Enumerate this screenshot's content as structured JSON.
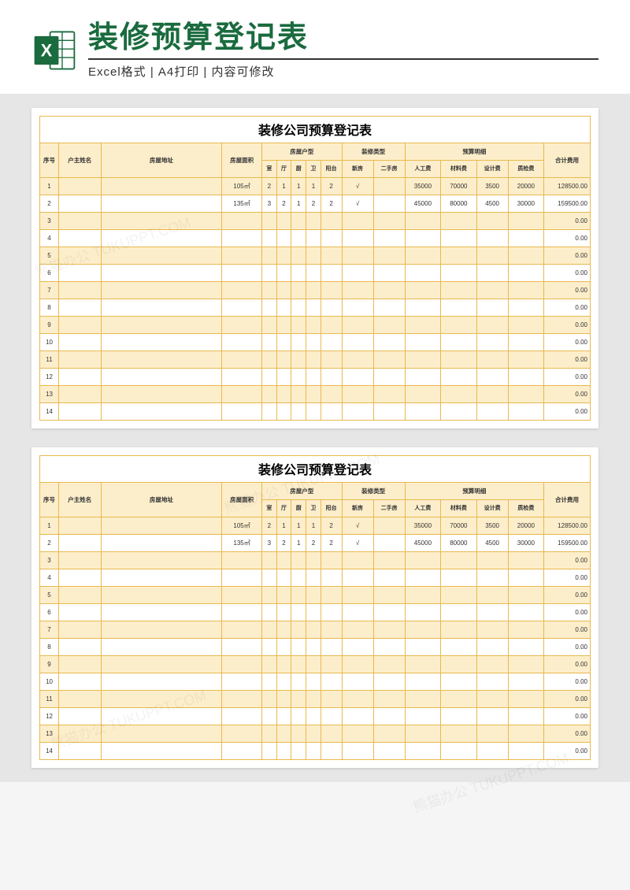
{
  "header": {
    "title": "装修预算登记表",
    "subtitle": "Excel格式 | A4打印 | 内容可修改",
    "icon_name": "excel-icon"
  },
  "sheet": {
    "title": "装修公司预算登记表",
    "columns": {
      "seq": "序号",
      "owner_name": "户主姓名",
      "address": "房屋地址",
      "area": "房屋面积",
      "house_type_group": "房屋户型",
      "room": "室",
      "hall": "厅",
      "kitchen": "厨",
      "bath": "卫",
      "balcony": "阳台",
      "decoration_type_group": "装修类型",
      "new_house": "新房",
      "second_hand": "二手房",
      "budget_detail_group": "预算明细",
      "labor_cost": "人工费",
      "material_cost": "材料费",
      "design_cost": "设计费",
      "quality_cost": "质检费",
      "total_cost": "合计费用"
    },
    "rows": [
      {
        "seq": "1",
        "owner_name": "",
        "address": "",
        "area": "105㎡",
        "room": "2",
        "hall": "1",
        "kitchen": "1",
        "bath": "1",
        "balcony": "2",
        "new_house": "√",
        "second_hand": "",
        "labor": "35000",
        "material": "70000",
        "design": "3500",
        "quality": "20000",
        "total": "128500.00"
      },
      {
        "seq": "2",
        "owner_name": "",
        "address": "",
        "area": "135㎡",
        "room": "3",
        "hall": "2",
        "kitchen": "1",
        "bath": "2",
        "balcony": "2",
        "new_house": "√",
        "second_hand": "",
        "labor": "45000",
        "material": "80000",
        "design": "4500",
        "quality": "30000",
        "total": "159500.00"
      },
      {
        "seq": "3",
        "owner_name": "",
        "address": "",
        "area": "",
        "room": "",
        "hall": "",
        "kitchen": "",
        "bath": "",
        "balcony": "",
        "new_house": "",
        "second_hand": "",
        "labor": "",
        "material": "",
        "design": "",
        "quality": "",
        "total": "0.00"
      },
      {
        "seq": "4",
        "owner_name": "",
        "address": "",
        "area": "",
        "room": "",
        "hall": "",
        "kitchen": "",
        "bath": "",
        "balcony": "",
        "new_house": "",
        "second_hand": "",
        "labor": "",
        "material": "",
        "design": "",
        "quality": "",
        "total": "0.00"
      },
      {
        "seq": "5",
        "owner_name": "",
        "address": "",
        "area": "",
        "room": "",
        "hall": "",
        "kitchen": "",
        "bath": "",
        "balcony": "",
        "new_house": "",
        "second_hand": "",
        "labor": "",
        "material": "",
        "design": "",
        "quality": "",
        "total": "0.00"
      },
      {
        "seq": "6",
        "owner_name": "",
        "address": "",
        "area": "",
        "room": "",
        "hall": "",
        "kitchen": "",
        "bath": "",
        "balcony": "",
        "new_house": "",
        "second_hand": "",
        "labor": "",
        "material": "",
        "design": "",
        "quality": "",
        "total": "0.00"
      },
      {
        "seq": "7",
        "owner_name": "",
        "address": "",
        "area": "",
        "room": "",
        "hall": "",
        "kitchen": "",
        "bath": "",
        "balcony": "",
        "new_house": "",
        "second_hand": "",
        "labor": "",
        "material": "",
        "design": "",
        "quality": "",
        "total": "0.00"
      },
      {
        "seq": "8",
        "owner_name": "",
        "address": "",
        "area": "",
        "room": "",
        "hall": "",
        "kitchen": "",
        "bath": "",
        "balcony": "",
        "new_house": "",
        "second_hand": "",
        "labor": "",
        "material": "",
        "design": "",
        "quality": "",
        "total": "0.00"
      },
      {
        "seq": "9",
        "owner_name": "",
        "address": "",
        "area": "",
        "room": "",
        "hall": "",
        "kitchen": "",
        "bath": "",
        "balcony": "",
        "new_house": "",
        "second_hand": "",
        "labor": "",
        "material": "",
        "design": "",
        "quality": "",
        "total": "0.00"
      },
      {
        "seq": "10",
        "owner_name": "",
        "address": "",
        "area": "",
        "room": "",
        "hall": "",
        "kitchen": "",
        "bath": "",
        "balcony": "",
        "new_house": "",
        "second_hand": "",
        "labor": "",
        "material": "",
        "design": "",
        "quality": "",
        "total": "0.00"
      },
      {
        "seq": "11",
        "owner_name": "",
        "address": "",
        "area": "",
        "room": "",
        "hall": "",
        "kitchen": "",
        "bath": "",
        "balcony": "",
        "new_house": "",
        "second_hand": "",
        "labor": "",
        "material": "",
        "design": "",
        "quality": "",
        "total": "0.00"
      },
      {
        "seq": "12",
        "owner_name": "",
        "address": "",
        "area": "",
        "room": "",
        "hall": "",
        "kitchen": "",
        "bath": "",
        "balcony": "",
        "new_house": "",
        "second_hand": "",
        "labor": "",
        "material": "",
        "design": "",
        "quality": "",
        "total": "0.00"
      },
      {
        "seq": "13",
        "owner_name": "",
        "address": "",
        "area": "",
        "room": "",
        "hall": "",
        "kitchen": "",
        "bath": "",
        "balcony": "",
        "new_house": "",
        "second_hand": "",
        "labor": "",
        "material": "",
        "design": "",
        "quality": "",
        "total": "0.00"
      },
      {
        "seq": "14",
        "owner_name": "",
        "address": "",
        "area": "",
        "room": "",
        "hall": "",
        "kitchen": "",
        "bath": "",
        "balcony": "",
        "new_house": "",
        "second_hand": "",
        "labor": "",
        "material": "",
        "design": "",
        "quality": "",
        "total": "0.00"
      }
    ]
  },
  "watermark_text": "熊猫办公 TUKUPPT.COM"
}
